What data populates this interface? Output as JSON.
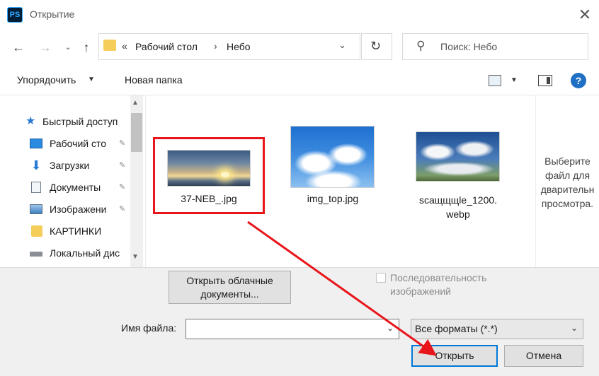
{
  "window": {
    "app_icon": "PS",
    "title": "Открытие",
    "close": "✕"
  },
  "nav": {
    "back": "←",
    "forward": "→",
    "recent": "⌄",
    "up": "↑",
    "breadcrumb_chevron": "«",
    "breadcrumb": [
      "Рабочий стол",
      "Небо"
    ],
    "breadcrumb_sep": "›",
    "dropdown": "⌄",
    "refresh": "↻",
    "search_placeholder": "Поиск: Небо"
  },
  "toolbar": {
    "organize": "Упорядочить",
    "organize_caret": "▼",
    "new_folder": "Новая папка",
    "view_caret": "▼",
    "help": "?"
  },
  "sidebar": {
    "items": [
      {
        "label": "Быстрый доступ",
        "icon": "star-icon",
        "pinned": false
      },
      {
        "label": "Рабочий сто",
        "icon": "desktop-icon",
        "pinned": true
      },
      {
        "label": "Загрузки",
        "icon": "download-icon",
        "pinned": true
      },
      {
        "label": "Документы",
        "icon": "documents-icon",
        "pinned": true
      },
      {
        "label": "Изображени",
        "icon": "pictures-icon",
        "pinned": true
      },
      {
        "label": "КАРТИНКИ",
        "icon": "folder-icon",
        "pinned": false
      },
      {
        "label": "Локальный дис",
        "icon": "drive-icon",
        "pinned": false
      }
    ],
    "pin_glyph": "📌",
    "scroll_up": "▲",
    "scroll_down": "▼"
  },
  "files": [
    {
      "name": "37-NEB_.jpg",
      "selected_highlight": true
    },
    {
      "name": "img_top.jpg",
      "selected_highlight": false
    },
    {
      "name_line1": "scaщщщle_1200.",
      "name_line2": "webp",
      "selected_highlight": false
    }
  ],
  "preview": {
    "lines": [
      "Выберите",
      "файл для",
      "дварительн",
      "просмотра."
    ]
  },
  "bottom": {
    "cloud_button_line1": "Открыть облачные",
    "cloud_button_line2": "документы...",
    "sequence_line1": "Последовательность",
    "sequence_line2": "изображений",
    "filename_label": "Имя файла:",
    "filename_value": "",
    "filename_caret": "⌄",
    "format_value": "Все форматы (*.*)",
    "format_caret": "⌄",
    "open_button": "Открыть",
    "cancel_button": "Отмена"
  },
  "colors": {
    "highlight": "#e8161b",
    "accent": "#0078d7",
    "arrow": "#e8161b"
  }
}
